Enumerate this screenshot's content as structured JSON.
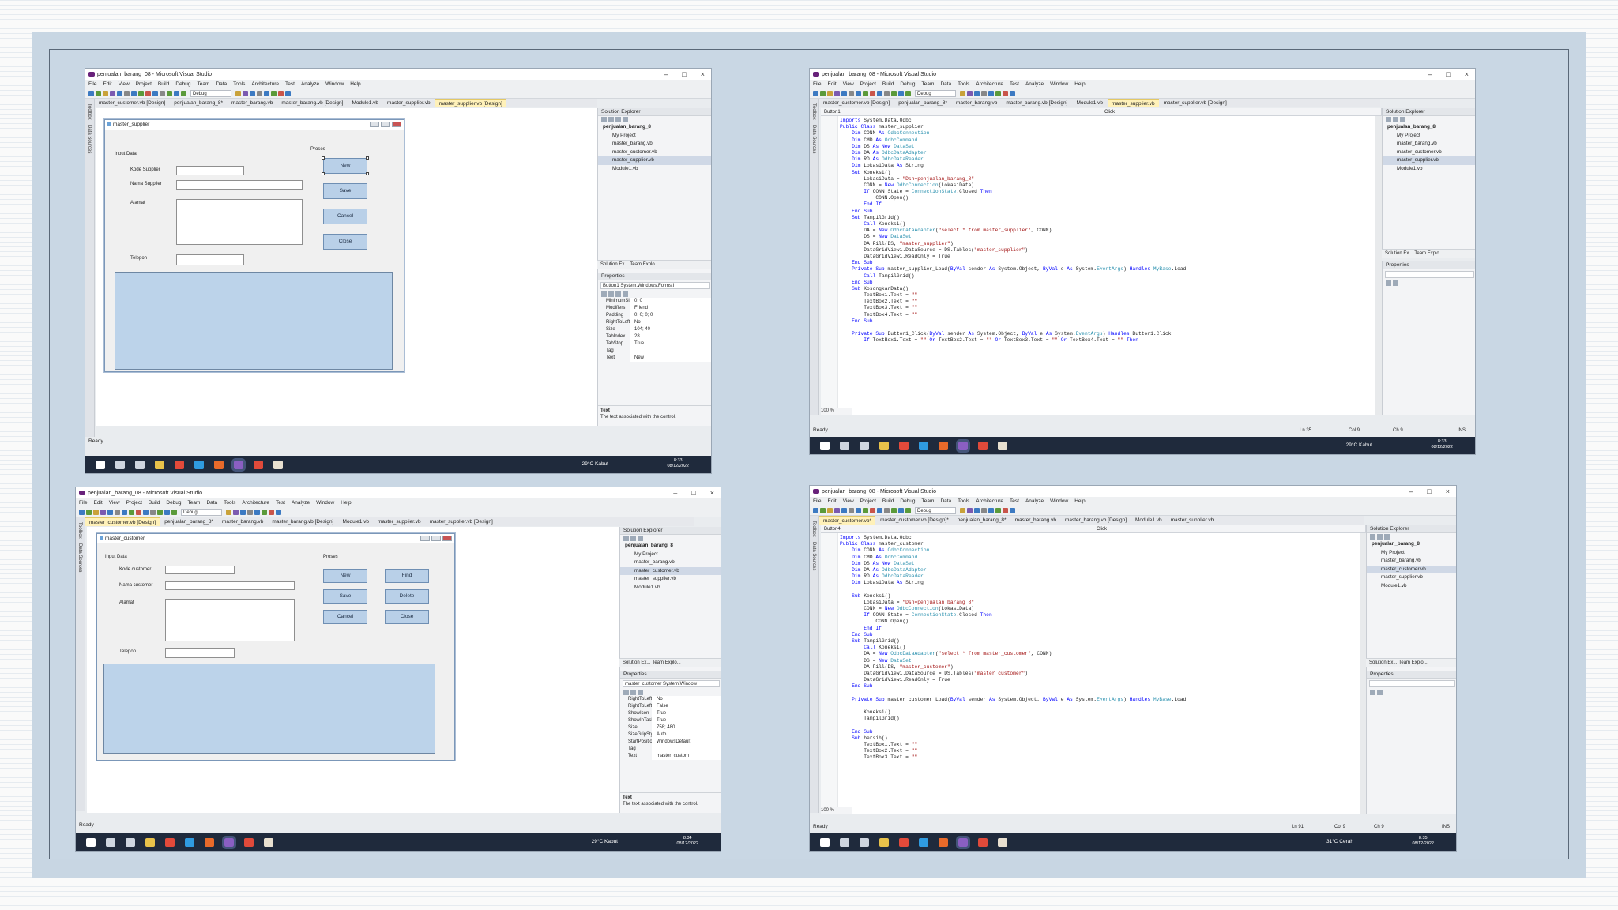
{
  "vs": {
    "menu": [
      "File",
      "Edit",
      "View",
      "Project",
      "Build",
      "Debug",
      "Team",
      "Data",
      "Tools",
      "Architecture",
      "Test",
      "Analyze",
      "Window",
      "Help"
    ],
    "debug": "Debug",
    "toolbox": "Toolbox",
    "datasources": "Data Sources",
    "status_ready": "Ready",
    "solution_explorer": "Solution Explorer",
    "properties": "Properties",
    "solution_tab": "Solution Ex...",
    "team_tab": "Team Explo...",
    "prop_desc_title": "Text",
    "prop_desc_text": "The text associated with the control."
  },
  "q1": {
    "title": "penjualan_barang_08 - Microsoft Visual Studio",
    "tabs": [
      "master_customer.vb [Design]",
      "penjualan_barang_8*",
      "master_barang.vb",
      "master_barang.vb [Design]",
      "Module1.vb",
      "master_supplier.vb",
      "master_supplier.vb [Design]"
    ],
    "form_title": "master_supplier",
    "group_input": "Input Data",
    "group_proses": "Proses",
    "labels": {
      "kode": "Kode Supplier",
      "nama": "Nama Supplier",
      "alamat": "Alamat",
      "telepon": "Telepon"
    },
    "buttons": {
      "new": "New",
      "save": "Save",
      "cancel": "Cancel",
      "close": "Close"
    },
    "tree": {
      "root": "penjualan_barang_8",
      "items": [
        "My Project",
        "master_barang.vb",
        "master_customer.vb",
        "master_supplier.vb",
        "Module1.vb"
      ]
    },
    "prop_object": "Button1  System.Windows.Forms.I",
    "props": [
      [
        "MinimumSiz",
        "0; 0"
      ],
      [
        "Modifiers",
        "Friend"
      ],
      [
        "Padding",
        "0; 0; 0; 0"
      ],
      [
        "RightToLeft",
        "No"
      ],
      [
        "Size",
        "104; 40"
      ],
      [
        "TabIndex",
        "28"
      ],
      [
        "TabStop",
        "True"
      ],
      [
        "Tag",
        ""
      ],
      [
        "Text",
        "New"
      ]
    ],
    "clock_time": "8:33",
    "clock_date": "08/12/2022",
    "weather": "29°C  Kabut"
  },
  "q2": {
    "title": "penjualan_barang_08 - Microsoft Visual Studio",
    "tabs": [
      "master_customer.vb [Design]",
      "penjualan_barang_8*",
      "master_barang.vb",
      "master_barang.vb [Design]",
      "Module1.vb",
      "master_supplier.vb",
      "master_supplier.vb [Design]"
    ],
    "dropdown_left": "Button1",
    "dropdown_right": "Click",
    "code": [
      "Imports System.Data.Odbc",
      "Public Class master_supplier",
      "    Dim CONN As OdbcConnection",
      "    Dim CMD As OdbcCommand",
      "    Dim DS As New DataSet",
      "    Dim DA As OdbcDataAdapter",
      "    Dim RD As OdbcDataReader",
      "    Dim LokasiData As String",
      "    Sub Koneksi()",
      "        LokasiData = \"Dsn=penjualan_barang_8\"",
      "        CONN = New OdbcConnection(LokasiData)",
      "        If CONN.State = ConnectionState.Closed Then",
      "            CONN.Open()",
      "        End If",
      "    End Sub",
      "    Sub TampilGrid()",
      "        Call Koneksi()",
      "        DA = New OdbcDataAdapter(\"select * from master_supplier\", CONN)",
      "        DS = New DataSet",
      "        DA.Fill(DS, \"master_supplier\")",
      "        DataGridView1.DataSource = DS.Tables(\"master_supplier\")",
      "        DataGridView1.ReadOnly = True",
      "    End Sub",
      "    Private Sub master_supplier_Load(ByVal sender As System.Object, ByVal e As System.EventArgs) Handles MyBase.Load",
      "        Call TampilGrid()",
      "    End Sub",
      "    Sub KosongkanData()",
      "        TextBox1.Text = \"\"",
      "        TextBox2.Text = \"\"",
      "        TextBox3.Text = \"\"",
      "        TextBox4.Text = \"\"",
      "    End Sub",
      "",
      "    Private Sub Button1_Click(ByVal sender As System.Object, ByVal e As System.EventArgs) Handles Button1.Click",
      "        If TextBox1.Text = \"\" Or TextBox2.Text = \"\" Or TextBox3.Text = \"\" Or TextBox4.Text = \"\" Then"
    ],
    "zoom": "100 %",
    "tree": {
      "root": "penjualan_barang_8",
      "items": [
        "My Project",
        "master_barang.vb",
        "master_customer.vb",
        "master_supplier.vb",
        "Module1.vb"
      ]
    },
    "ln": "Ln 35",
    "col": "Col 9",
    "ch": "Ch 9",
    "ins": "INS",
    "clock_time": "8:33",
    "clock_date": "08/12/2022",
    "weather": "29°C  Kabut"
  },
  "q3": {
    "title": "penjualan_barang_08 - Microsoft Visual Studio",
    "tabs": [
      "master_customer.vb [Design]",
      "penjualan_barang_8*",
      "master_barang.vb",
      "master_barang.vb [Design]",
      "Module1.vb",
      "master_supplier.vb",
      "master_supplier.vb [Design]"
    ],
    "form_title": "master_customer",
    "group_input": "Input Data",
    "group_proses": "Proses",
    "labels": {
      "kode": "Kode customer",
      "nama": "Nama customer",
      "alamat": "Alamat",
      "telepon": "Telepon"
    },
    "buttons": {
      "new": "New",
      "find": "Find",
      "save": "Save",
      "delete": "Delete",
      "cancel": "Cancel",
      "close": "Close"
    },
    "tree": {
      "root": "penjualan_barang_8",
      "items": [
        "My Project",
        "master_barang.vb",
        "master_customer.vb",
        "master_supplier.vb",
        "Module1.vb"
      ]
    },
    "prop_object": "master_customer  System.Window",
    "props": [
      [
        "RightToLeft",
        "No"
      ],
      [
        "RightToLeftLa",
        "False"
      ],
      [
        "ShowIcon",
        "True"
      ],
      [
        "ShowInTaskbi",
        "True"
      ],
      [
        "Size",
        "758; 480"
      ],
      [
        "SizeGripStyle",
        "Auto"
      ],
      [
        "StartPosition",
        "WindowsDefault"
      ],
      [
        "Tag",
        ""
      ],
      [
        "Text",
        "master_custom"
      ]
    ],
    "clock_time": "8:34",
    "clock_date": "08/12/2022",
    "weather": "29°C  Kabut"
  },
  "q4": {
    "title": "penjualan_barang_08 - Microsoft Visual Studio",
    "tabs": [
      "master_customer.vb*",
      "master_customer.vb [Design]*",
      "penjualan_barang_8*",
      "master_barang.vb",
      "master_barang.vb [Design]",
      "Module1.vb",
      "master_supplier.vb"
    ],
    "dropdown_left": "Button4",
    "dropdown_right": "Click",
    "code": [
      "Imports System.Data.Odbc",
      "Public Class master_customer",
      "    Dim CONN As OdbcConnection",
      "    Dim CMD As OdbcCommand",
      "    Dim DS As New DataSet",
      "    Dim DA As OdbcDataAdapter",
      "    Dim RD As OdbcDataReader",
      "    Dim LokasiData As String",
      "",
      "    Sub Koneksi()",
      "        LokasiData = \"Dsn=penjualan_barang_8\"",
      "        CONN = New OdbcConnection(LokasiData)",
      "        If CONN.State = ConnectionState.Closed Then",
      "            CONN.Open()",
      "        End If",
      "    End Sub",
      "    Sub TampilGrid()",
      "        Call Koneksi()",
      "        DA = New OdbcDataAdapter(\"select * from master_customer\", CONN)",
      "        DS = New DataSet",
      "        DA.Fill(DS, \"master_customer\")",
      "        DataGridView1.DataSource = DS.Tables(\"master_customer\")",
      "        DataGridView1.ReadOnly = True",
      "    End Sub",
      "",
      "    Private Sub master_customer_Load(ByVal sender As System.Object, ByVal e As System.EventArgs) Handles MyBase.Load",
      "",
      "        Koneksi()",
      "        TampilGrid()",
      "",
      "    End Sub",
      "    Sub bersih()",
      "        TextBox1.Text = \"\"",
      "        TextBox2.Text = \"\"",
      "        TextBox3.Text = \"\""
    ],
    "zoom": "100 %",
    "tree": {
      "root": "penjualan_barang_8",
      "items": [
        "My Project",
        "master_barang.vb",
        "master_customer.vb",
        "master_supplier.vb",
        "Module1.vb"
      ]
    },
    "ln": "Ln 91",
    "col": "Col 9",
    "ch": "Ch 9",
    "ins": "INS",
    "clock_time": "8:35",
    "clock_date": "08/12/2022",
    "weather": "31°C  Cerah"
  }
}
